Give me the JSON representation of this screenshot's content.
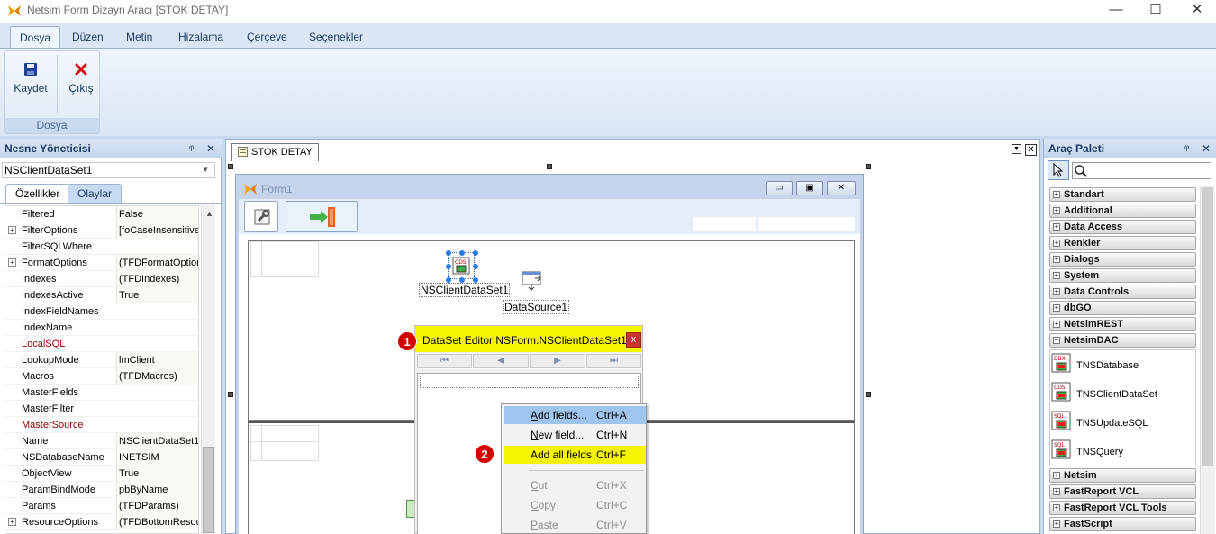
{
  "app": {
    "title": "Netsim Form Dizayn Aracı [STOK DETAY]",
    "minimize": "—",
    "maximize": "☐",
    "close": "✕"
  },
  "menu": {
    "tabs": [
      "Dosya",
      "Düzen",
      "Metin",
      "Hizalama",
      "Çerçeve",
      "Seçenekler"
    ],
    "active": "Dosya"
  },
  "ribbon": {
    "save_label": "Kaydet",
    "exit_label": "Çıkış",
    "group_label": "Dosya"
  },
  "object_manager": {
    "title": "Nesne Yöneticisi",
    "pin": "ᵠ",
    "close": "✕",
    "selected_object": "NSClientDataSet1",
    "tabs": [
      "Özellikler",
      "Olaylar"
    ],
    "properties": [
      {
        "name": "Filtered",
        "value": "False",
        "expandable": false,
        "highlight": false
      },
      {
        "name": "FilterOptions",
        "value": "[foCaseInsensitive",
        "expandable": true,
        "highlight": false
      },
      {
        "name": "FilterSQLWhere",
        "value": "",
        "expandable": false,
        "highlight": false
      },
      {
        "name": "FormatOptions",
        "value": "(TFDFormatOption",
        "expandable": true,
        "highlight": false
      },
      {
        "name": "Indexes",
        "value": "(TFDIndexes)",
        "expandable": false,
        "highlight": false
      },
      {
        "name": "IndexesActive",
        "value": "True",
        "expandable": false,
        "highlight": false
      },
      {
        "name": "IndexFieldNames",
        "value": "",
        "expandable": false,
        "highlight": false
      },
      {
        "name": "IndexName",
        "value": "",
        "expandable": false,
        "highlight": false
      },
      {
        "name": "LocalSQL",
        "value": "",
        "expandable": false,
        "highlight": true
      },
      {
        "name": "LookupMode",
        "value": "lmClient",
        "expandable": false,
        "highlight": false
      },
      {
        "name": "Macros",
        "value": "(TFDMacros)",
        "expandable": false,
        "highlight": false
      },
      {
        "name": "MasterFields",
        "value": "",
        "expandable": false,
        "highlight": false
      },
      {
        "name": "MasterFilter",
        "value": "",
        "expandable": false,
        "highlight": false
      },
      {
        "name": "MasterSource",
        "value": "",
        "expandable": false,
        "highlight": true
      },
      {
        "name": "Name",
        "value": "NSClientDataSet1",
        "expandable": false,
        "highlight": false
      },
      {
        "name": "NSDatabaseName",
        "value": "INETSIM",
        "expandable": false,
        "highlight": false
      },
      {
        "name": "ObjectView",
        "value": "True",
        "expandable": false,
        "highlight": false
      },
      {
        "name": "ParamBindMode",
        "value": "pbByName",
        "expandable": false,
        "highlight": false
      },
      {
        "name": "Params",
        "value": "(TFDParams)",
        "expandable": false,
        "highlight": false
      },
      {
        "name": "ResourceOptions",
        "value": "(TFDBottomResour",
        "expandable": true,
        "highlight": false
      }
    ]
  },
  "document": {
    "tab_label": "STOK DETAY",
    "form_title": "Form1",
    "components": [
      {
        "label": "NSClientDataSet1"
      },
      {
        "label": "DataSource1"
      }
    ]
  },
  "dataset_editor": {
    "title": "DataSet Editor NSForm.NSClientDataSet1",
    "close": "x",
    "nav": [
      "⏮",
      "◀",
      "▶",
      "⏭"
    ],
    "badge": "1"
  },
  "context_menu": {
    "items": [
      {
        "underline": "A",
        "rest": "dd fields...",
        "shortcut": "Ctrl+A",
        "enabled": true,
        "state": "hover"
      },
      {
        "underline": "N",
        "rest": "ew field...",
        "shortcut": "Ctrl+N",
        "enabled": true,
        "state": "normal"
      },
      {
        "underline": "",
        "rest": "Add all fields",
        "shortcut": "Ctrl+F",
        "enabled": true,
        "state": "highlight"
      },
      {
        "underline": "",
        "rest": "",
        "shortcut": "",
        "enabled": true,
        "state": "separator"
      },
      {
        "underline": "C",
        "rest": "ut",
        "shortcut": "Ctrl+X",
        "enabled": false,
        "state": "normal"
      },
      {
        "underline": "C",
        "rest": "opy",
        "shortcut": "Ctrl+C",
        "enabled": false,
        "state": "normal"
      },
      {
        "underline": "P",
        "rest": "aste",
        "shortcut": "Ctrl+V",
        "enabled": false,
        "state": "normal"
      }
    ],
    "badge": "2"
  },
  "palette": {
    "title": "Araç Paleti",
    "pin": "ᵠ",
    "close": "✕",
    "search_value": "",
    "categories_top": [
      "Standart",
      "Additional",
      "Data Access",
      "Renkler",
      "Dialogs",
      "System",
      "Data Controls",
      "dbGO",
      "NetsimREST"
    ],
    "open_category": "NetsimDAC",
    "components": [
      {
        "label": "TNSDatabase",
        "icon_text": "DBX"
      },
      {
        "label": "TNSClientDataSet",
        "icon_text": "CDS"
      },
      {
        "label": "TNSUpdateSQL",
        "icon_text": "SQL"
      },
      {
        "label": "TNSQuery",
        "icon_text": "SQL"
      }
    ],
    "categories_bottom": [
      "Netsim",
      "FastReport VCL",
      "FastReport VCL Tools",
      "FastScript"
    ],
    "colors": {
      "accent": "#d40000",
      "highlight": "#f6f600",
      "hover": "#9fc4ee"
    }
  }
}
